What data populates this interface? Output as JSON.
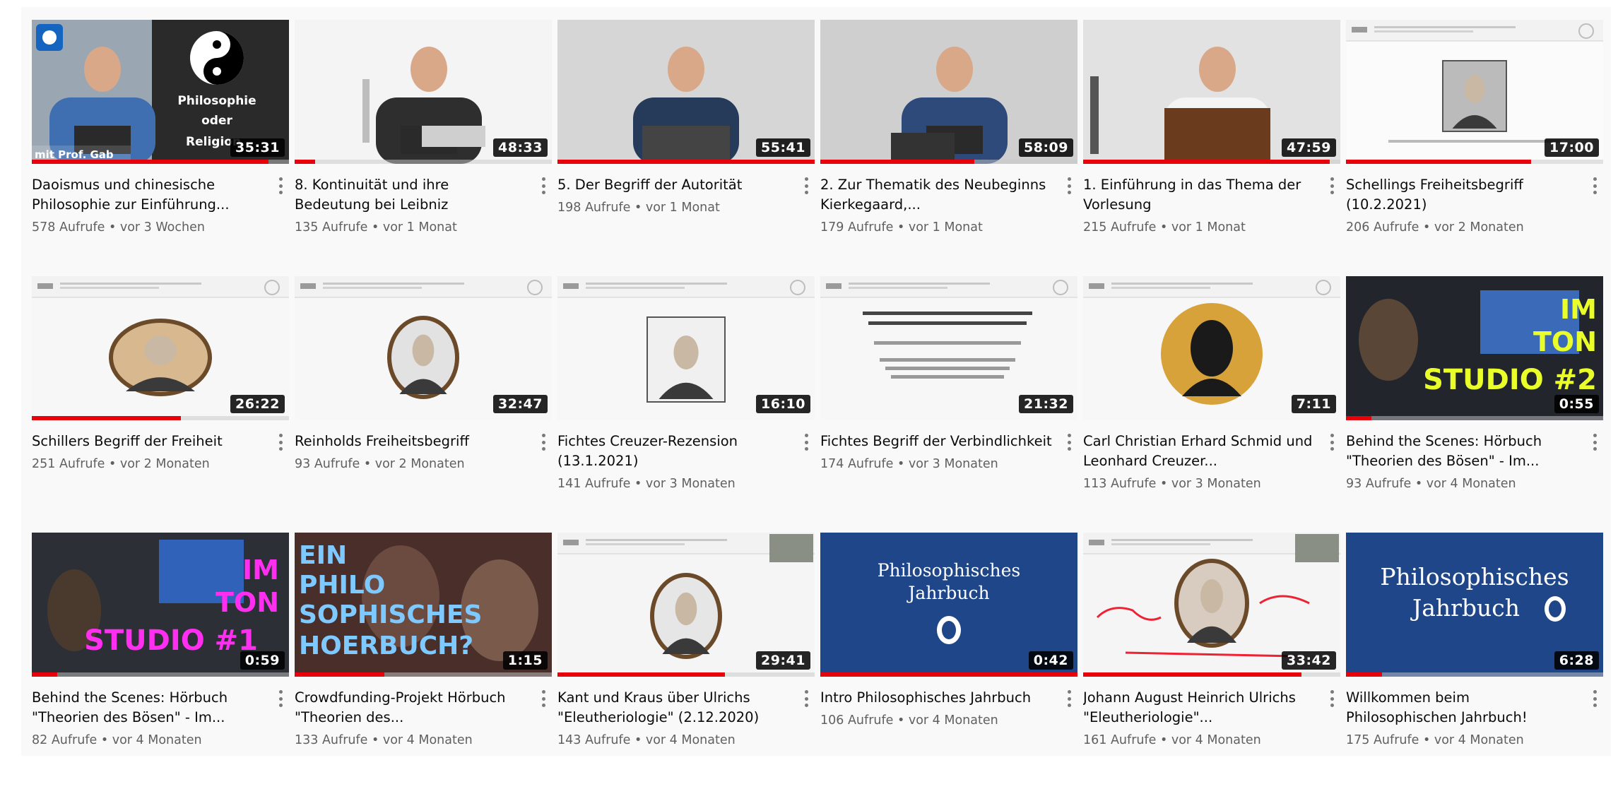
{
  "videos": [
    {
      "title": "Daoismus und chinesische Philosophie zur Einführung...",
      "views": "578 Aufrufe",
      "age": "vor 3 Wochen",
      "duration": "35:31",
      "progress": 0.92,
      "thumb": "daoismus",
      "lines": [
        "Philosophie",
        "oder",
        "Religion"
      ],
      "overlay": "mit Prof. Gab"
    },
    {
      "title": "8. Kontinuität und ihre Bedeutung bei Leibniz",
      "views": "135 Aufrufe",
      "age": "vor 1 Monat",
      "duration": "48:33",
      "progress": 0.08,
      "thumb": "lecture1"
    },
    {
      "title": "5. Der Begriff der Autorität",
      "views": "198 Aufrufe",
      "age": "vor 1 Monat",
      "duration": "55:41",
      "progress": 1.0,
      "thumb": "lecture2"
    },
    {
      "title": "2. Zur Thematik des Neubeginns Kierkegaard,...",
      "views": "179 Aufrufe",
      "age": "vor 1 Monat",
      "duration": "58:09",
      "progress": 0.6,
      "thumb": "lecture3"
    },
    {
      "title": "1. Einführung in das Thema der Vorlesung",
      "views": "215 Aufrufe",
      "age": "vor 1 Monat",
      "duration": "47:59",
      "progress": 0.96,
      "thumb": "lecture4"
    },
    {
      "title": "Schellings Freiheitsbegriff (10.2.2021)",
      "views": "206 Aufrufe",
      "age": "vor 2 Monaten",
      "duration": "17:00",
      "progress": 0.72,
      "thumb": "portrait-dark"
    },
    {
      "title": "Schillers Begriff der Freiheit",
      "views": "251 Aufrufe",
      "age": "vor 2 Monaten",
      "duration": "26:22",
      "progress": 0.58,
      "thumb": "portrait-oval"
    },
    {
      "title": "Reinholds Freiheitsbegriff",
      "views": "93 Aufrufe",
      "age": "vor 2 Monaten",
      "duration": "32:47",
      "progress": 0.0,
      "thumb": "portrait-sketch"
    },
    {
      "title": "Fichtes Creuzer-Rezension (13.1.2021)",
      "views": "141 Aufrufe",
      "age": "vor 3 Monaten",
      "duration": "16:10",
      "progress": 0.0,
      "thumb": "portrait-sketch2"
    },
    {
      "title": "Fichtes Begriff der Verbindlichkeit",
      "views": "174 Aufrufe",
      "age": "vor 3 Monaten",
      "duration": "21:32",
      "progress": 0.0,
      "thumb": "slide-text"
    },
    {
      "title": "Carl Christian Erhard Schmid und Leonhard Creuzer...",
      "views": "113 Aufrufe",
      "age": "vor 3 Monaten",
      "duration": "7:11",
      "progress": 0.0,
      "thumb": "silhouette"
    },
    {
      "title": "Behind the Scenes: Hörbuch \"Theorien des Bösen\" - Im...",
      "views": "93 Aufrufe",
      "age": "vor 4 Monaten",
      "duration": "0:55",
      "progress": 0.1,
      "thumb": "studio2",
      "lines": [
        "IM",
        "TON",
        "STUDIO #2"
      ]
    },
    {
      "title": "Behind the Scenes: Hörbuch \"Theorien des Bösen\" - Im...",
      "views": "82 Aufrufe",
      "age": "vor 4 Monaten",
      "duration": "0:59",
      "progress": 0.1,
      "thumb": "studio1",
      "lines": [
        "IM",
        "TON",
        "STUDIO #1"
      ]
    },
    {
      "title": "Crowdfunding-Projekt Hörbuch \"Theorien des...",
      "views": "133 Aufrufe",
      "age": "vor 4 Monaten",
      "duration": "1:15",
      "progress": 0.35,
      "thumb": "hoerbuch",
      "lines": [
        "EIN",
        "PHILO",
        "SOPHISCHES",
        "HOERBUCH?"
      ]
    },
    {
      "title": "Kant und Kraus über Ulrichs \"Eleutheriologie\" (2.12.2020)",
      "views": "143 Aufrufe",
      "age": "vor 4 Monaten",
      "duration": "29:41",
      "progress": 0.65,
      "thumb": "portrait-cam"
    },
    {
      "title": "Intro Philosophisches Jahrbuch",
      "views": "106 Aufrufe",
      "age": "vor 4 Monaten",
      "duration": "0:42",
      "progress": 1.0,
      "thumb": "jahrbuch",
      "lines": [
        "Philosophisches",
        "Jahrbuch"
      ]
    },
    {
      "title": "Johann August Heinrich Ulrichs \"Eleutheriologie\"...",
      "views": "161 Aufrufe",
      "age": "vor 4 Monaten",
      "duration": "33:42",
      "progress": 0.85,
      "thumb": "portrait-annot"
    },
    {
      "title": "Willkommen beim Philosophischen Jahrbuch!",
      "views": "175 Aufrufe",
      "age": "vor 4 Monaten",
      "duration": "6:28",
      "progress": 0.14,
      "thumb": "jahrbuch2",
      "lines": [
        "Philosophisches",
        "Jahrbuch"
      ]
    }
  ],
  "separator": " • "
}
